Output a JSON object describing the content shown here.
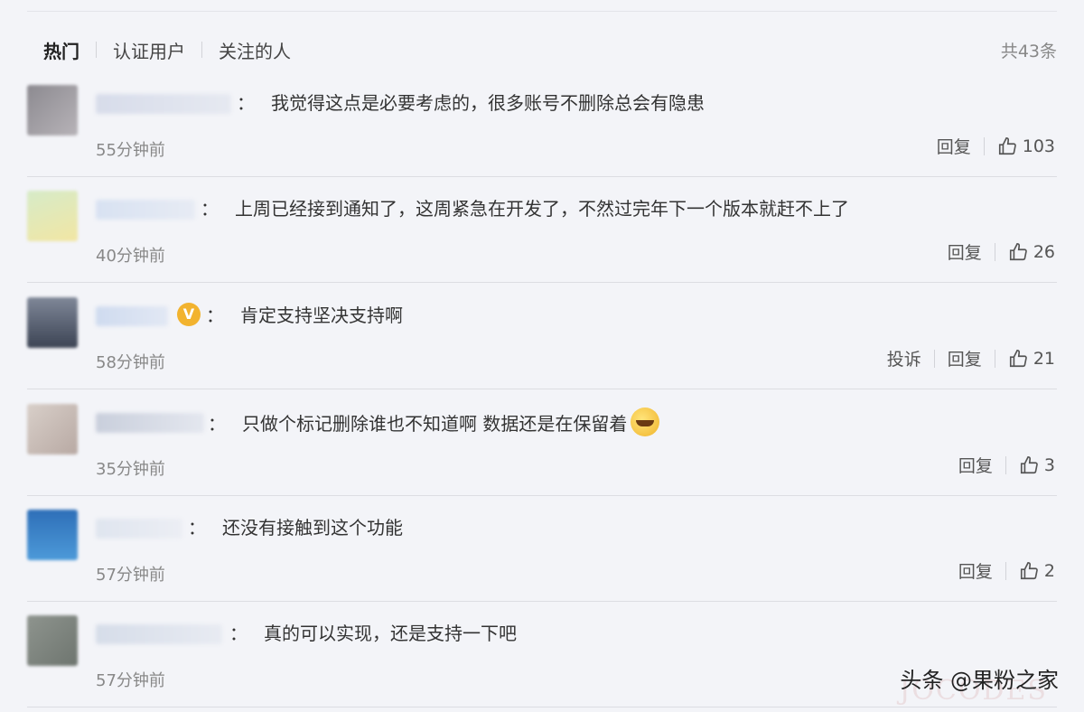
{
  "tabs": [
    "热门",
    "认证用户",
    "关注的人"
  ],
  "total": "共43条",
  "reply_label": "回复",
  "report_label": "投诉",
  "colors": {
    "background": "#f3f4f8",
    "verified": "#f2b32f"
  },
  "comments": [
    {
      "text": "我觉得这点是必要考虑的，很多账号不删除总会有隐患",
      "time": "55分钟前",
      "likes": "103"
    },
    {
      "text": "上周已经接到通知了，这周紧急在开发了，不然过完年下一个版本就赶不上了",
      "time": "40分钟前",
      "likes": "26"
    },
    {
      "text": "肯定支持坚决支持啊",
      "time": "58分钟前",
      "likes": "21"
    },
    {
      "text": "只做个标记删除谁也不知道啊 数据还是在保留着",
      "time": "35分钟前",
      "likes": "3"
    },
    {
      "text": "还没有接触到这个功能",
      "time": "57分钟前",
      "likes": "2"
    },
    {
      "text": "真的可以实现，还是支持一下吧",
      "time": "57分钟前",
      "likes": ""
    }
  ],
  "watermark": "头条 @果粉之家",
  "watermark_faint": "JOCODES",
  "verified_mark": "V",
  "colon": "："
}
